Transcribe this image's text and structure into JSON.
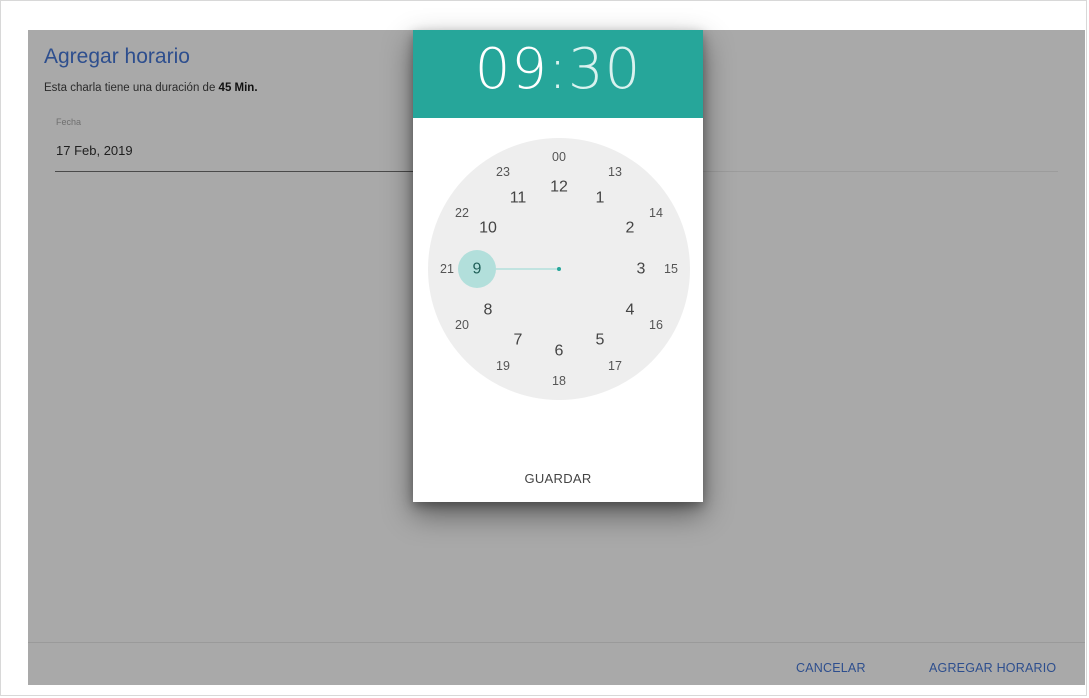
{
  "dialog": {
    "title": "Agregar horario",
    "subtitle_prefix": "Esta charla tiene una duración de",
    "duration": "45 Min.",
    "date_label": "Fecha",
    "date_value": "17 Feb, 2019",
    "cancel_label": "CANCELAR",
    "submit_label": "AGREGAR HORARIO"
  },
  "picker": {
    "hours": "09",
    "separator": ":",
    "minutes": "30",
    "selected_hour": "9",
    "save_label": "GUARDAR",
    "outer_ring": [
      "12",
      "1",
      "2",
      "3",
      "4",
      "5",
      "6",
      "7",
      "8",
      "9",
      "10",
      "11"
    ],
    "inner_ring": [
      "00",
      "13",
      "14",
      "15",
      "16",
      "17",
      "18",
      "19",
      "20",
      "21",
      "22",
      "23"
    ]
  },
  "colors": {
    "accent": "#26a69a",
    "highlight": "#b2dfdb",
    "link": "#2d4e8e",
    "backdrop": "#a9a9a9"
  }
}
